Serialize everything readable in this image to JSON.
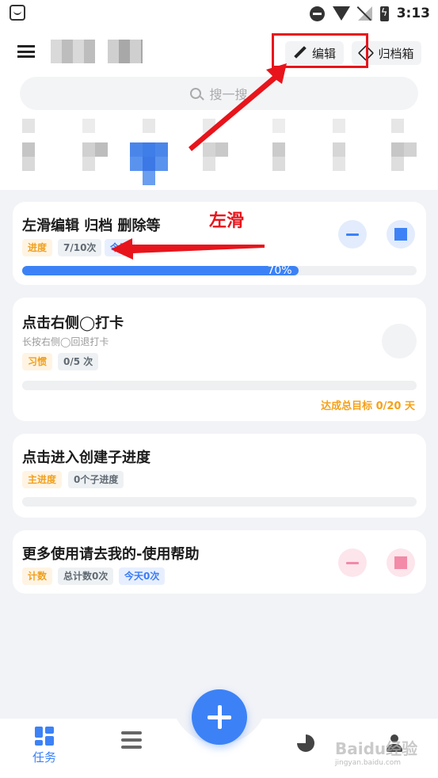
{
  "status_bar": {
    "time": "3:13"
  },
  "header": {
    "edit_label": "编辑",
    "archive_label": "归档箱",
    "search_placeholder": "搜一搜"
  },
  "cards": [
    {
      "title": "左滑编辑 归档 删除等",
      "tags": [
        "进度",
        "7/10次",
        "今天"
      ],
      "progress_percent": 70,
      "progress_label": "70%"
    },
    {
      "title": "点击右侧◯打卡",
      "subtitle": "长按右侧◯回退打卡",
      "tags": [
        "习惯",
        "0/5 次"
      ],
      "goal_text": "达成总目标 0/20 天"
    },
    {
      "title": "点击进入创建子进度",
      "tags": [
        "主进度",
        "0个子进度"
      ]
    },
    {
      "title": "更多使用请去我的-使用帮助",
      "tags": [
        "计数",
        "总计数0次",
        "今天0次"
      ]
    }
  ],
  "annotation": {
    "label": "左滑"
  },
  "bottom_nav": {
    "tasks_label": "任务",
    "watermark": "Baidu经验",
    "watermark_url": "jingyan.baidu.com"
  },
  "colors": {
    "accent": "#3c82f6",
    "orange": "#f5a11b",
    "annotation_red": "#e8141b",
    "pink": "#f28aa8"
  }
}
